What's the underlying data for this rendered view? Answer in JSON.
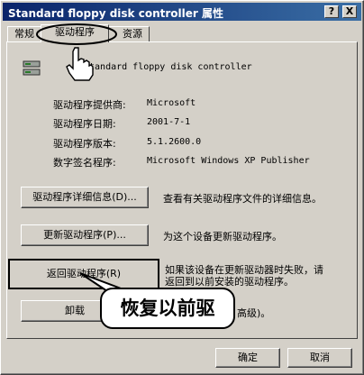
{
  "window": {
    "title": "Standard floppy disk controller 属性",
    "help_label": "?",
    "close_label": "X"
  },
  "tabs": [
    {
      "label": "常规"
    },
    {
      "label": "驱动程序"
    },
    {
      "label": "资源"
    }
  ],
  "device_name": "Standard floppy disk controller",
  "info": {
    "provider_label": "驱动程序提供商:",
    "provider_value": "Microsoft",
    "date_label": "驱动程序日期:",
    "date_value": "2001-7-1",
    "version_label": "驱动程序版本:",
    "version_value": "5.1.2600.0",
    "signer_label": "数字签名程序:",
    "signer_value": "Microsoft Windows XP Publisher"
  },
  "actions": {
    "details_button": "驱动程序详细信息(D)...",
    "details_desc": "查看有关驱动程序文件的详细信息。",
    "update_button": "更新驱动程序(P)...",
    "update_desc": "为这个设备更新驱动程序。",
    "rollback_button": "返回驱动程序(R)",
    "rollback_desc_line1": "如果该设备在更新驱动器时失败，请",
    "rollback_desc_line2": "返回到以前安装的驱动程序。",
    "uninstall_button_partial": "卸载",
    "uninstall_desc_partial": "高级)。"
  },
  "callout_text": "恢复以前驱",
  "footer": {
    "ok_label": "确定",
    "cancel_label": "取消"
  }
}
